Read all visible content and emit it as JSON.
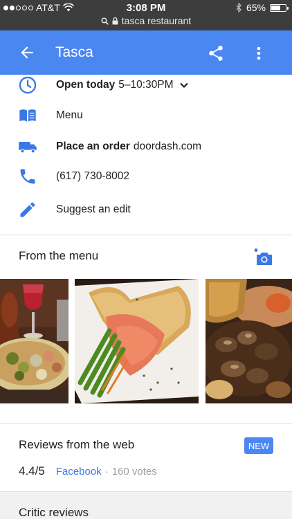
{
  "status_bar": {
    "carrier": "AT&T",
    "time": "3:08 PM",
    "battery": "65%",
    "battery_level": 0.65,
    "signal_bars_filled": 2,
    "signal_bars_total": 5,
    "url": "tasca restaurant"
  },
  "app_bar": {
    "title": "Tasca",
    "color": "#4b87f1"
  },
  "info": {
    "hours_label": "Open today",
    "hours_value": "5–10:30PM",
    "menu_label": "Menu",
    "order_label": "Place an order",
    "order_value": "doordash.com",
    "phone": "(617) 730-8002",
    "suggest_edit": "Suggest an edit"
  },
  "menu_section": {
    "title": "From the menu"
  },
  "reviews_section": {
    "title": "Reviews from the web",
    "badge": "NEW",
    "score": "4.4/5",
    "source": "Facebook",
    "separator": "·",
    "votes": "160 votes"
  },
  "critic_section": {
    "title": "Critic reviews"
  },
  "colors": {
    "accent_blue": "#4b87f1",
    "icon_blue": "#3b78e7",
    "link_blue": "#3b78e7"
  }
}
